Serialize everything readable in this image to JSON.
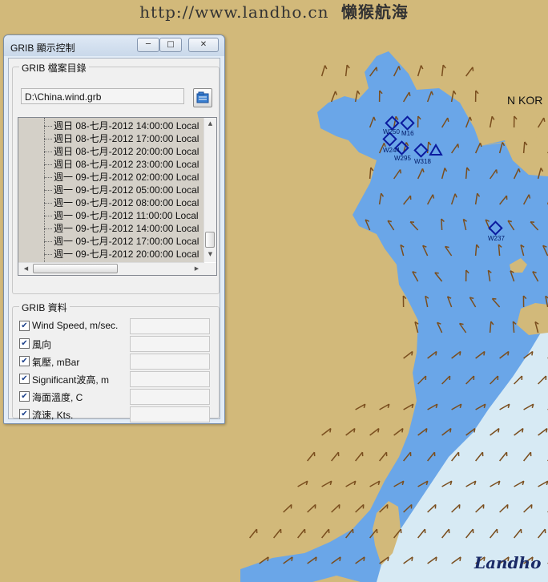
{
  "banner": {
    "url": "http://www.landho.cn",
    "chinese": "懒猴航海"
  },
  "map": {
    "region_label": "N KOR",
    "waypoints": [
      "W250",
      "M16",
      "W244",
      "W295",
      "W318",
      "W237"
    ],
    "logo": "Landho",
    "colors": {
      "land": "#d2b97a",
      "sea": "#6aa6e8",
      "shallow": "#d7eaf4",
      "arrow": "#7a4e1e",
      "waypoint": "#0a1a9e"
    }
  },
  "window": {
    "title": "GRIB 顯示控制",
    "buttons": {
      "minimize": "─",
      "maximize": "□",
      "close": "✕"
    },
    "catalog": {
      "group_label": "GRIB 檔案目錄",
      "file_path": "D:\\China.wind.grb",
      "entries": [
        "週日 08-七月-2012 14:00:00 Local",
        "週日 08-七月-2012 17:00:00 Local",
        "週日 08-七月-2012 20:00:00 Local",
        "週日 08-七月-2012 23:00:00 Local",
        "週一 09-七月-2012 02:00:00 Local",
        "週一 09-七月-2012 05:00:00 Local",
        "週一 09-七月-2012 08:00:00 Local",
        "週一 09-七月-2012 11:00:00 Local",
        "週一 09-七月-2012 14:00:00 Local",
        "週一 09-七月-2012 17:00:00 Local",
        "週一 09-七月-2012 20:00:00 Local"
      ]
    },
    "data": {
      "group_label": "GRIB 資料",
      "fields": [
        {
          "label": "Wind Speed, m/sec.",
          "checked": true,
          "value": ""
        },
        {
          "label": "風向",
          "checked": true,
          "value": ""
        },
        {
          "label": "氣壓, mBar",
          "checked": true,
          "value": ""
        },
        {
          "label": "Significant波高, m",
          "checked": true,
          "value": ""
        },
        {
          "label": "海面溫度, C",
          "checked": true,
          "value": ""
        },
        {
          "label": "流速, Kts.",
          "checked": true,
          "value": ""
        }
      ]
    }
  }
}
